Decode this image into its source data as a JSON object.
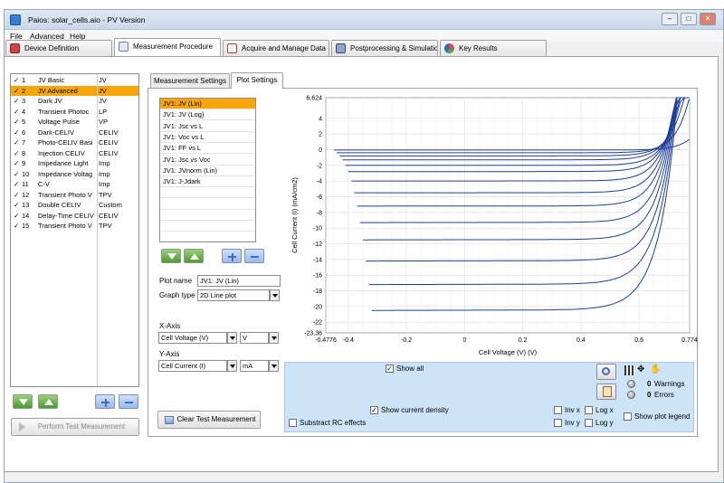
{
  "window": {
    "title": "Paios: solar_cells.aio  -  PV Version"
  },
  "menu": [
    "File",
    "Advanced",
    "Help"
  ],
  "main_tabs": [
    {
      "label": "Device Definition",
      "icon": "device-icon"
    },
    {
      "label": "Measurement Procedure",
      "icon": "clipboard-icon"
    },
    {
      "label": "Acquire and Manage Data",
      "icon": "acquire-icon"
    },
    {
      "label": "Postprocessing & Simulatio",
      "icon": "postprocess-icon"
    },
    {
      "label": "Key Results",
      "icon": "results-icon"
    }
  ],
  "steps": [
    {
      "check": "✓",
      "num": "1",
      "name": "JV Basic",
      "type": "JV"
    },
    {
      "check": "✓",
      "num": "2",
      "name": "JV Advanced",
      "type": "JV"
    },
    {
      "check": "✓",
      "num": "3",
      "name": "Dark JV",
      "type": "JV"
    },
    {
      "check": "✓",
      "num": "4",
      "name": "Transient Photoc",
      "type": "LP"
    },
    {
      "check": "✓",
      "num": "5",
      "name": "Voltage Pulse",
      "type": "VP"
    },
    {
      "check": "✓",
      "num": "6",
      "name": "Dark-CELIV",
      "type": "CELIV"
    },
    {
      "check": "✓",
      "num": "7",
      "name": "Photo-CELIV Basi",
      "type": "CELIV"
    },
    {
      "check": "✓",
      "num": "8",
      "name": "Injection CELIV",
      "type": "CELIV"
    },
    {
      "check": "✓",
      "num": "9",
      "name": "Impedance Light",
      "type": "Imp"
    },
    {
      "check": "✓",
      "num": "10",
      "name": "Impedance Voltag",
      "type": "Imp"
    },
    {
      "check": "✓",
      "num": "11",
      "name": "C-V",
      "type": "Imp"
    },
    {
      "check": "✓",
      "num": "12",
      "name": "Transient Photo V",
      "type": "TPV"
    },
    {
      "check": "✓",
      "num": "13",
      "name": "Double CELIV",
      "type": "Custom"
    },
    {
      "check": "✓",
      "num": "14",
      "name": "Delay-Time CELIV",
      "type": "CELIV"
    },
    {
      "check": "✓",
      "num": "15",
      "name": "Transient Photo V",
      "type": "TPV"
    }
  ],
  "selected_step": 1,
  "perform_button": "Perform Test Measurement",
  "inner_tabs": [
    "Measurement Settings",
    "Plot Settings"
  ],
  "plots": [
    "JV1: JV (Lin)",
    "JV1: JV (Log)",
    "JV1: Jsc vs L",
    "JV1: Voc vs L",
    "JV1: FF vs L",
    "JV1: Jsc vs Voc",
    "JV1: JVnorm (Lin)",
    "JV1: J-Jdark"
  ],
  "selected_plot": 0,
  "plot_name_label": "Plot name",
  "plot_name_value": "JV1: JV (Lin)",
  "graph_type_label": "Graph type",
  "graph_type_value": "2D Line plot",
  "x_axis": {
    "label": "X-Axis",
    "quantity": "Cell Voltage (V)",
    "unit": "V"
  },
  "y_axis": {
    "label": "Y-Axis",
    "quantity": "Cell Current (I)",
    "unit": "mA"
  },
  "clear_button": "Clear Test Measurement",
  "show_all": {
    "label": "Show all",
    "checked": true
  },
  "show_current_density": {
    "label": "Show current density",
    "checked": true
  },
  "substract_rc": {
    "label": "Substract RC effects",
    "checked": false
  },
  "inv_x": "Inv x",
  "inv_y": "Inv y",
  "log_x": "Log x",
  "log_y": "Log y",
  "show_legend": "Show plot legend",
  "warnings": {
    "count": "0",
    "label": "Warnings"
  },
  "errors": {
    "count": "0",
    "label": "Errors"
  },
  "check_mark": "✓",
  "colors": {
    "selection": "#f7a60a",
    "series": "#1f3f99",
    "panel_blue": "#cde3f8"
  },
  "chart_data": {
    "type": "line",
    "xlabel": "Cell Voltage (V) (V)",
    "ylabel": "Cell Current (I) (mA/cm2)",
    "xlim": [
      -0.4776,
      0.774
    ],
    "ylim": [
      -23.36,
      6.624
    ],
    "xticks": [
      "-0.4776",
      "-0.4",
      "-0.2",
      "0",
      "0.2",
      "0.4",
      "0.6",
      "0.774"
    ],
    "yticks": [
      "6.624",
      "4",
      "2",
      "0",
      "-2",
      "-4",
      "-6",
      "-8",
      "-10",
      "-12",
      "-14",
      "-16",
      "-18",
      "-20",
      "-22",
      "-23.36"
    ],
    "grid": true,
    "series": [
      {
        "x0": -0.45,
        "jsc": -0.05,
        "voc": 0.62
      },
      {
        "x0": -0.44,
        "jsc": -0.4,
        "voc": 0.64
      },
      {
        "x0": -0.43,
        "jsc": -0.8,
        "voc": 0.65
      },
      {
        "x0": -0.42,
        "jsc": -1.3,
        "voc": 0.66
      },
      {
        "x0": -0.41,
        "jsc": -2.0,
        "voc": 0.67
      },
      {
        "x0": -0.4,
        "jsc": -2.8,
        "voc": 0.675
      },
      {
        "x0": -0.39,
        "jsc": -4.0,
        "voc": 0.68
      },
      {
        "x0": -0.38,
        "jsc": -5.5,
        "voc": 0.685
      },
      {
        "x0": -0.37,
        "jsc": -7.2,
        "voc": 0.69
      },
      {
        "x0": -0.36,
        "jsc": -9.3,
        "voc": 0.695
      },
      {
        "x0": -0.35,
        "jsc": -11.5,
        "voc": 0.7
      },
      {
        "x0": -0.34,
        "jsc": -14.2,
        "voc": 0.705
      },
      {
        "x0": -0.33,
        "jsc": -17.2,
        "voc": 0.71
      },
      {
        "x0": -0.32,
        "jsc": -20.5,
        "voc": 0.715
      }
    ]
  }
}
